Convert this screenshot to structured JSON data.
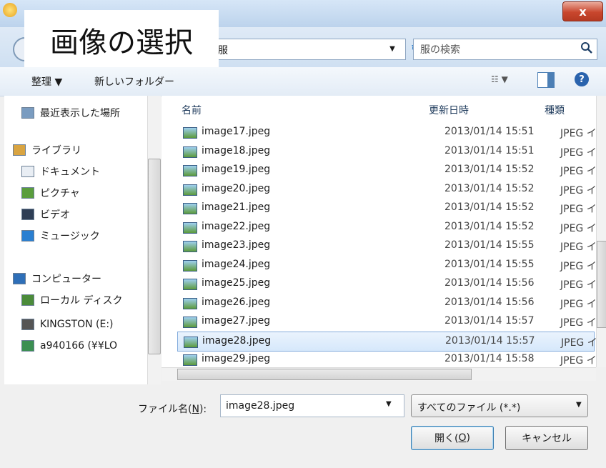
{
  "window": {
    "close_label": "x"
  },
  "caption": "画像の選択",
  "address": {
    "tail_text": "服",
    "search_placeholder": "服の検索"
  },
  "toolbar": {
    "organize": "整理 ▼",
    "new_folder": "新しいフォルダー"
  },
  "nav": [
    {
      "label": "最近表示した場所",
      "icon": "recent-places-icon"
    },
    {
      "label": "ライブラリ",
      "icon": "library-icon"
    },
    {
      "label": "ドキュメント",
      "icon": "document-icon"
    },
    {
      "label": "ピクチャ",
      "icon": "pictures-icon"
    },
    {
      "label": "ビデオ",
      "icon": "video-icon"
    },
    {
      "label": "ミュージック",
      "icon": "music-icon"
    },
    {
      "label": "コンピューター",
      "icon": "computer-icon"
    },
    {
      "label": "ローカル ディスク",
      "icon": "local-disk-icon"
    },
    {
      "label": "KINGSTON (E:)",
      "icon": "usb-drive-icon"
    },
    {
      "label": "a940166 (¥¥LO",
      "icon": "network-drive-icon"
    }
  ],
  "columns": {
    "name": "名前",
    "date": "更新日時",
    "type": "種類"
  },
  "files": [
    {
      "name": "image17.jpeg",
      "date": "2013/01/14 15:51",
      "type": "JPEG イメ"
    },
    {
      "name": "image18.jpeg",
      "date": "2013/01/14 15:51",
      "type": "JPEG イメ"
    },
    {
      "name": "image19.jpeg",
      "date": "2013/01/14 15:52",
      "type": "JPEG イメ"
    },
    {
      "name": "image20.jpeg",
      "date": "2013/01/14 15:52",
      "type": "JPEG イメ"
    },
    {
      "name": "image21.jpeg",
      "date": "2013/01/14 15:52",
      "type": "JPEG イメ"
    },
    {
      "name": "image22.jpeg",
      "date": "2013/01/14 15:52",
      "type": "JPEG イメ"
    },
    {
      "name": "image23.jpeg",
      "date": "2013/01/14 15:55",
      "type": "JPEG イメ"
    },
    {
      "name": "image24.jpeg",
      "date": "2013/01/14 15:55",
      "type": "JPEG イメ"
    },
    {
      "name": "image25.jpeg",
      "date": "2013/01/14 15:56",
      "type": "JPEG イメ"
    },
    {
      "name": "image26.jpeg",
      "date": "2013/01/14 15:56",
      "type": "JPEG イメ"
    },
    {
      "name": "image27.jpeg",
      "date": "2013/01/14 15:57",
      "type": "JPEG イメ"
    },
    {
      "name": "image28.jpeg",
      "date": "2013/01/14 15:57",
      "type": "JPEG イメ"
    },
    {
      "name": "image29.jpeg",
      "date": "2013/01/14 15:58",
      "type": "JPEG イメ"
    }
  ],
  "selected_file": "image28.jpeg",
  "filename": {
    "label_pre": "ファイル名(",
    "label_key": "N",
    "label_post": "):",
    "value": "image28.jpeg"
  },
  "filetype": {
    "value": "すべてのファイル (*.*)"
  },
  "buttons": {
    "open_pre": "開く(",
    "open_key": "O",
    "open_post": ")",
    "cancel": "キャンセル"
  },
  "colors": {
    "selection": "#d6e8fb",
    "accent": "#3c7fb1"
  }
}
